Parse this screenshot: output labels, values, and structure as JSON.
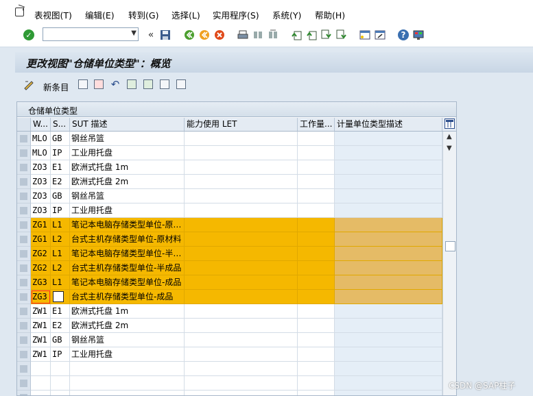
{
  "menu": {
    "items": [
      "表视图(T)",
      "编辑(E)",
      "转到(G)",
      "选择(L)",
      "实用程序(S)",
      "系统(Y)",
      "帮助(H)"
    ]
  },
  "toolbar": {
    "command_value": "",
    "icons": [
      "enter-icon",
      "back-icon",
      "exit-icon",
      "cancel-icon",
      "print-icon",
      "find-icon",
      "find-next-icon",
      "first-page-icon",
      "prev-page-icon",
      "next-page-icon",
      "last-page-icon",
      "new-session-icon",
      "shortcut-icon",
      "help-icon",
      "layout-icon"
    ]
  },
  "title": "更改视图\"仓储单位类型\"：概览",
  "app_toolbar": {
    "new_entries_label": "新条目"
  },
  "table": {
    "title": "仓储单位类型",
    "headers": [
      "W...",
      "S...",
      "SUT 描述",
      "能力使用 LET",
      "工作量...",
      "计量单位类型描述"
    ],
    "rows": [
      {
        "w": "MLO",
        "s": "GB",
        "desc": "钢丝吊篮",
        "let": "",
        "work": "",
        "uom": "",
        "hl": false
      },
      {
        "w": "MLO",
        "s": "IP",
        "desc": "工业用托盘",
        "let": "",
        "work": "",
        "uom": "",
        "hl": false
      },
      {
        "w": "ZO3",
        "s": "E1",
        "desc": "欧洲式托盘 1m",
        "let": "",
        "work": "",
        "uom": "",
        "hl": false
      },
      {
        "w": "ZO3",
        "s": "E2",
        "desc": "欧洲式托盘 2m",
        "let": "",
        "work": "",
        "uom": "",
        "hl": false
      },
      {
        "w": "ZO3",
        "s": "GB",
        "desc": "钢丝吊篮",
        "let": "",
        "work": "",
        "uom": "",
        "hl": false
      },
      {
        "w": "ZO3",
        "s": "IP",
        "desc": "工业用托盘",
        "let": "",
        "work": "",
        "uom": "",
        "hl": false
      },
      {
        "w": "ZG1",
        "s": "L1",
        "desc": "笔记本电脑存储类型单位-原…",
        "let": "",
        "work": "",
        "uom": "",
        "hl": true
      },
      {
        "w": "ZG1",
        "s": "L2",
        "desc": "台式主机存储类型单位-原材料",
        "let": "",
        "work": "",
        "uom": "",
        "hl": true
      },
      {
        "w": "ZG2",
        "s": "L1",
        "desc": "笔记本电脑存储类型单位-半…",
        "let": "",
        "work": "",
        "uom": "",
        "hl": true
      },
      {
        "w": "ZG2",
        "s": "L2",
        "desc": "台式主机存储类型单位-半成品",
        "let": "",
        "work": "",
        "uom": "",
        "hl": true
      },
      {
        "w": "ZG3",
        "s": "L1",
        "desc": "笔记本电脑存储类型单位-成品",
        "let": "",
        "work": "",
        "uom": "",
        "hl": true
      },
      {
        "w": "ZG3",
        "s": "",
        "desc": "台式主机存储类型单位-成品",
        "let": "",
        "work": "",
        "uom": "",
        "hl": true,
        "focus": true
      },
      {
        "w": "ZW1",
        "s": "E1",
        "desc": "欧洲式托盘 1m",
        "let": "",
        "work": "",
        "uom": "",
        "hl": false
      },
      {
        "w": "ZW1",
        "s": "E2",
        "desc": "欧洲式托盘 2m",
        "let": "",
        "work": "",
        "uom": "",
        "hl": false
      },
      {
        "w": "ZW1",
        "s": "GB",
        "desc": "钢丝吊篮",
        "let": "",
        "work": "",
        "uom": "",
        "hl": false
      },
      {
        "w": "ZW1",
        "s": "IP",
        "desc": "工业用托盘",
        "let": "",
        "work": "",
        "uom": "",
        "hl": false
      },
      {
        "w": "",
        "s": "",
        "desc": "",
        "let": "",
        "work": "",
        "uom": "",
        "hl": false
      },
      {
        "w": "",
        "s": "",
        "desc": "",
        "let": "",
        "work": "",
        "uom": "",
        "hl": false
      },
      {
        "w": "",
        "s": "",
        "desc": "",
        "let": "",
        "work": "",
        "uom": "",
        "hl": false
      }
    ]
  },
  "watermark": "CSDN @SAP柱子",
  "colors": {
    "highlight": "#f5b800",
    "background": "#dfe8f1"
  }
}
